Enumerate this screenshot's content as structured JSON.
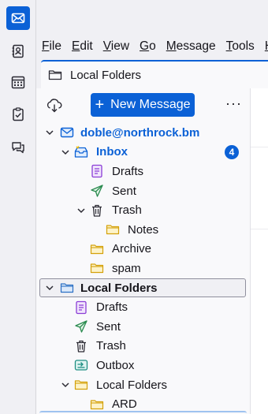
{
  "menubar": {
    "items": [
      {
        "key": "F",
        "rest": "ile"
      },
      {
        "key": "E",
        "rest": "dit"
      },
      {
        "key": "V",
        "rest": "iew"
      },
      {
        "key": "G",
        "rest": "o"
      },
      {
        "key": "M",
        "rest": "essage"
      },
      {
        "key": "T",
        "rest": "ools"
      },
      {
        "key": "H",
        "rest": ""
      }
    ]
  },
  "tab": {
    "label": "Local Folders"
  },
  "pane": {
    "new_message_label": "New Message",
    "more_label": "···"
  },
  "tree": {
    "account": {
      "label": "doble@northrock.bm"
    },
    "inbox": {
      "label": "Inbox",
      "unread": "4"
    },
    "account_drafts": {
      "label": "Drafts"
    },
    "account_sent": {
      "label": "Sent"
    },
    "account_trash": {
      "label": "Trash"
    },
    "account_notes": {
      "label": "Notes"
    },
    "account_archive": {
      "label": "Archive"
    },
    "account_spam": {
      "label": "spam"
    },
    "local": {
      "label": "Local Folders"
    },
    "local_drafts": {
      "label": "Drafts"
    },
    "local_sent": {
      "label": "Sent"
    },
    "local_trash": {
      "label": "Trash"
    },
    "local_outbox": {
      "label": "Outbox"
    },
    "local_sub": {
      "label": "Local Folders"
    },
    "local_ard": {
      "label": "ARD"
    }
  },
  "colors": {
    "accent": "#0b61d6",
    "folder_yellow": "#f5c211",
    "drafts_purple": "#8b3dd6",
    "sent_green": "#2a8a4f"
  }
}
